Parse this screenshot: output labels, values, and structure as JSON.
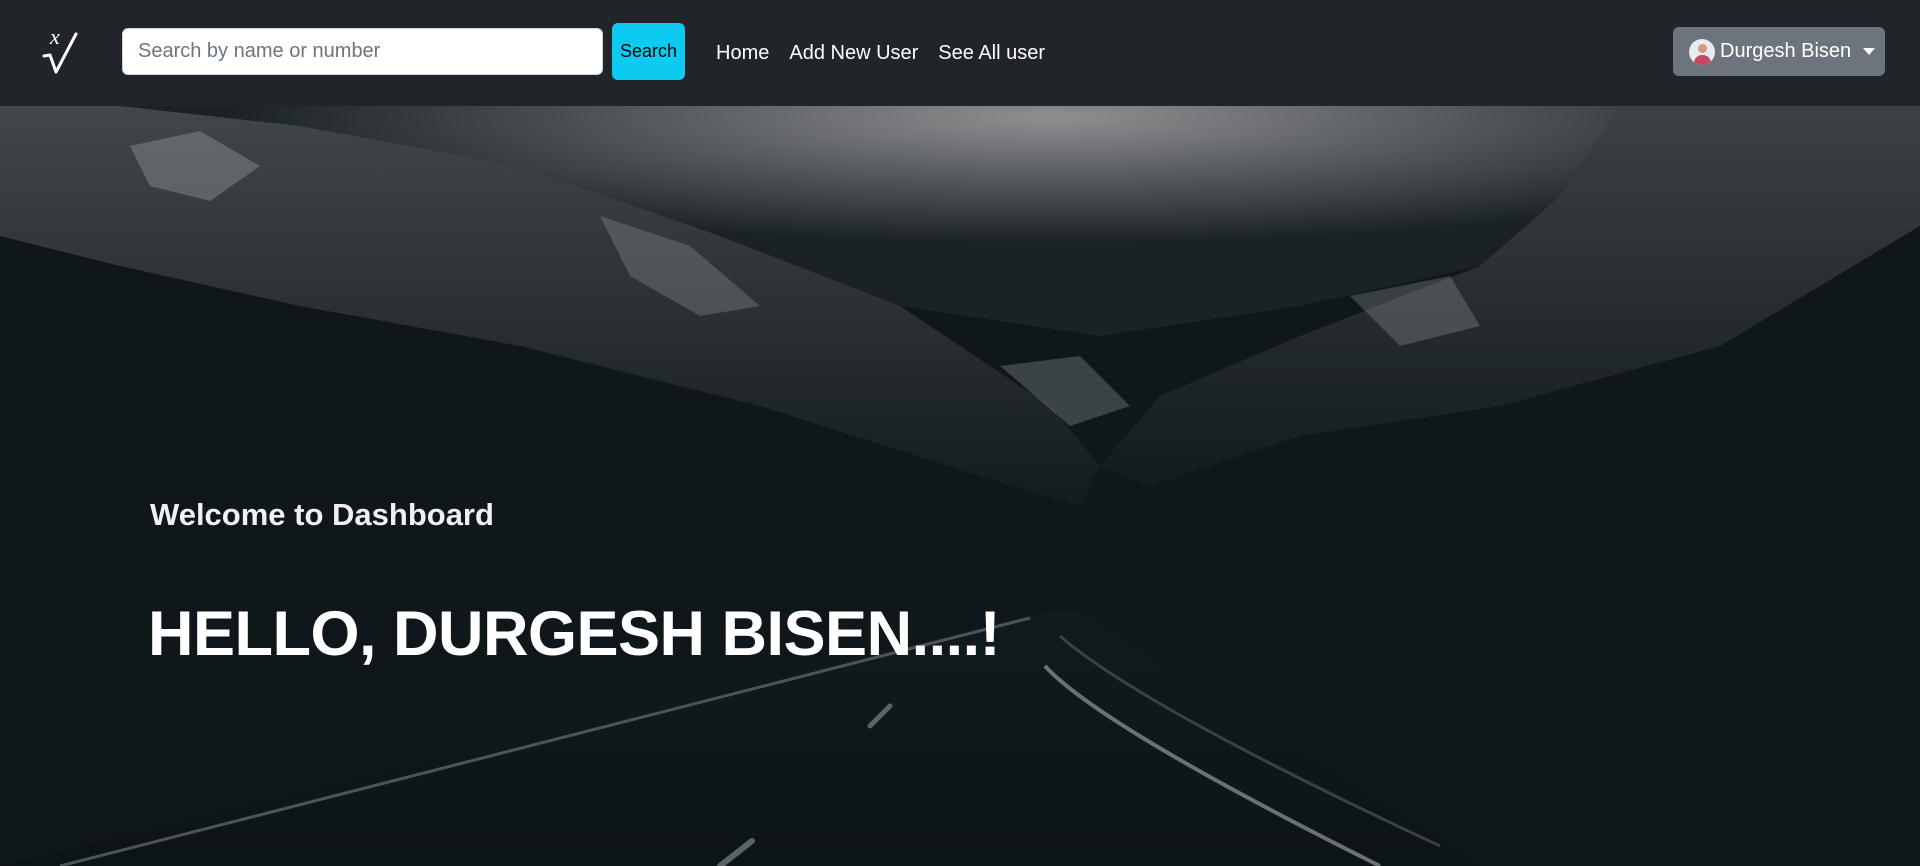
{
  "navbar": {
    "logo_icon": "xv-root-logo-icon",
    "search": {
      "placeholder": "Search by name or number",
      "value": "",
      "button_label": "Search"
    },
    "links": [
      {
        "label": "Home"
      },
      {
        "label": "Add New User"
      },
      {
        "label": "See All user"
      }
    ],
    "user": {
      "name": "Durgesh Bisen",
      "avatar_icon": "user-avatar",
      "dropdown_icon": "caret-down-icon"
    }
  },
  "hero": {
    "subtitle": "Welcome to Dashboard",
    "greeting": "HELLO, DURGESH BISEN....!",
    "background": "dark mountain valley road photo"
  },
  "colors": {
    "navbar_bg": "#212529",
    "search_button": "#0dcaf0",
    "user_button": "#6c757d",
    "hero_bg": "#0e1619"
  }
}
